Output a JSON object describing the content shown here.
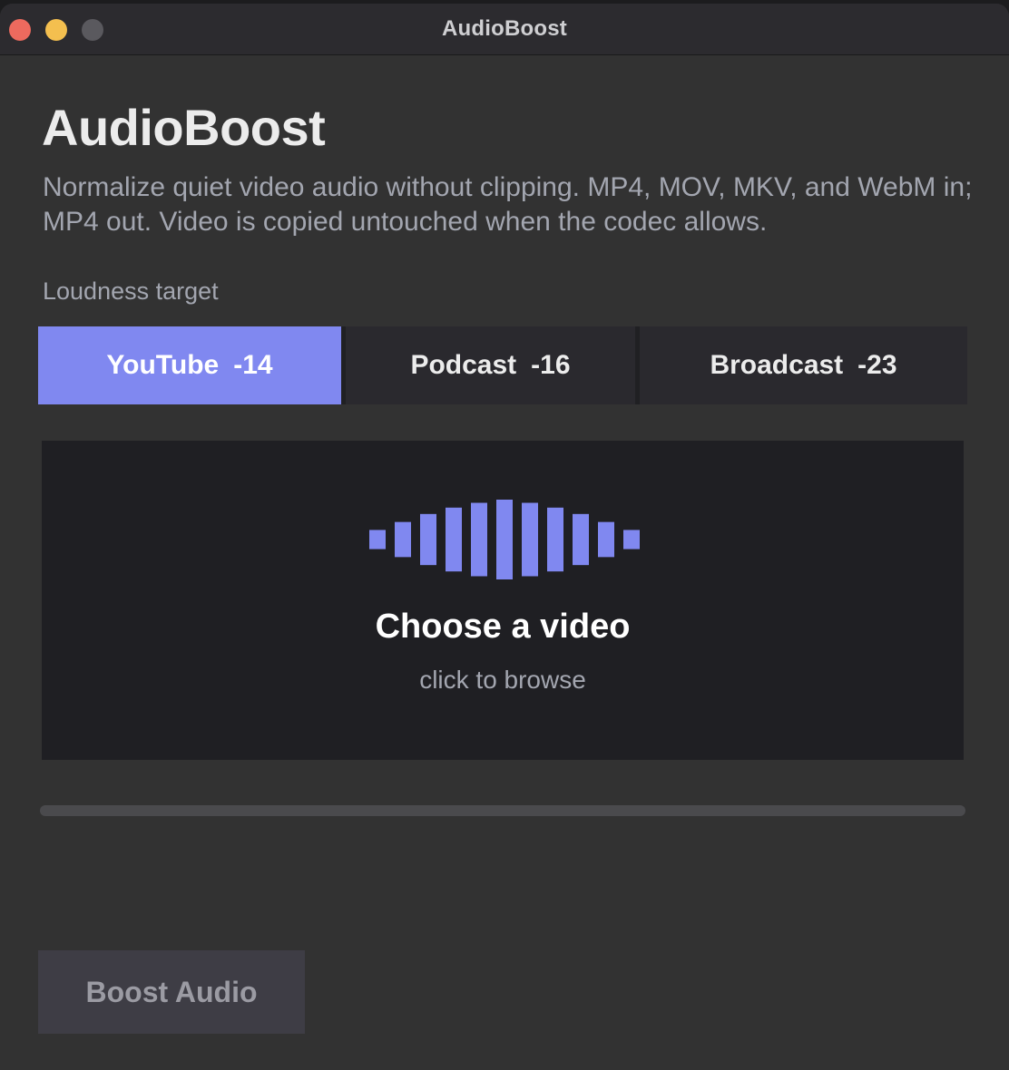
{
  "window": {
    "title": "AudioBoost"
  },
  "app": {
    "heading": "AudioBoost",
    "description": "Normalize quiet video audio without clipping. MP4, MOV, MKV, and WebM in; MP4 out. Video is copied untouched when the codec allows."
  },
  "loudness": {
    "label": "Loudness target",
    "options": [
      {
        "name": "YouTube",
        "value": "-14",
        "selected": true
      },
      {
        "name": "Podcast",
        "value": "-16",
        "selected": false
      },
      {
        "name": "Broadcast",
        "value": "-23",
        "selected": false
      }
    ]
  },
  "dropzone": {
    "icon": "waveform-icon",
    "title": "Choose a video",
    "subtitle": "click to browse",
    "wave_levels": [
      0.24,
      0.44,
      0.64,
      0.8,
      0.92,
      1.0,
      0.92,
      0.8,
      0.64,
      0.44,
      0.24
    ]
  },
  "progress": {
    "fraction": 0
  },
  "actions": {
    "boost_label": "Boost Audio"
  },
  "colors": {
    "accent": "#8088f0",
    "background": "#323232",
    "dropzone_bg": "#1f1f23",
    "button_disabled_bg": "#3e3d45"
  }
}
